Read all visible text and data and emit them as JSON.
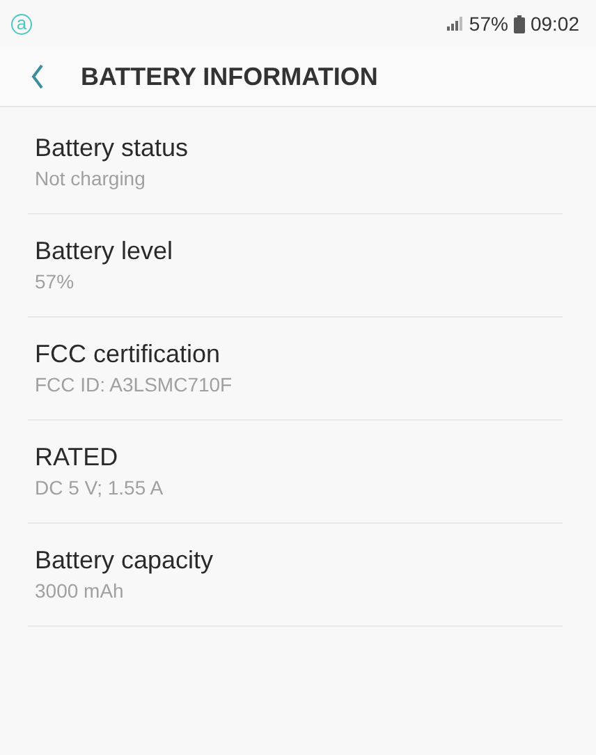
{
  "status_bar": {
    "app_badge": "a",
    "battery": "57%",
    "time": "09:02"
  },
  "header": {
    "title": "BATTERY INFORMATION"
  },
  "items": [
    {
      "title": "Battery status",
      "value": "Not charging"
    },
    {
      "title": "Battery level",
      "value": "57%"
    },
    {
      "title": "FCC certification",
      "value": "FCC ID: A3LSMC710F"
    },
    {
      "title": "RATED",
      "value": "DC 5 V; 1.55 A"
    },
    {
      "title": "Battery capacity",
      "value": "3000 mAh"
    }
  ]
}
